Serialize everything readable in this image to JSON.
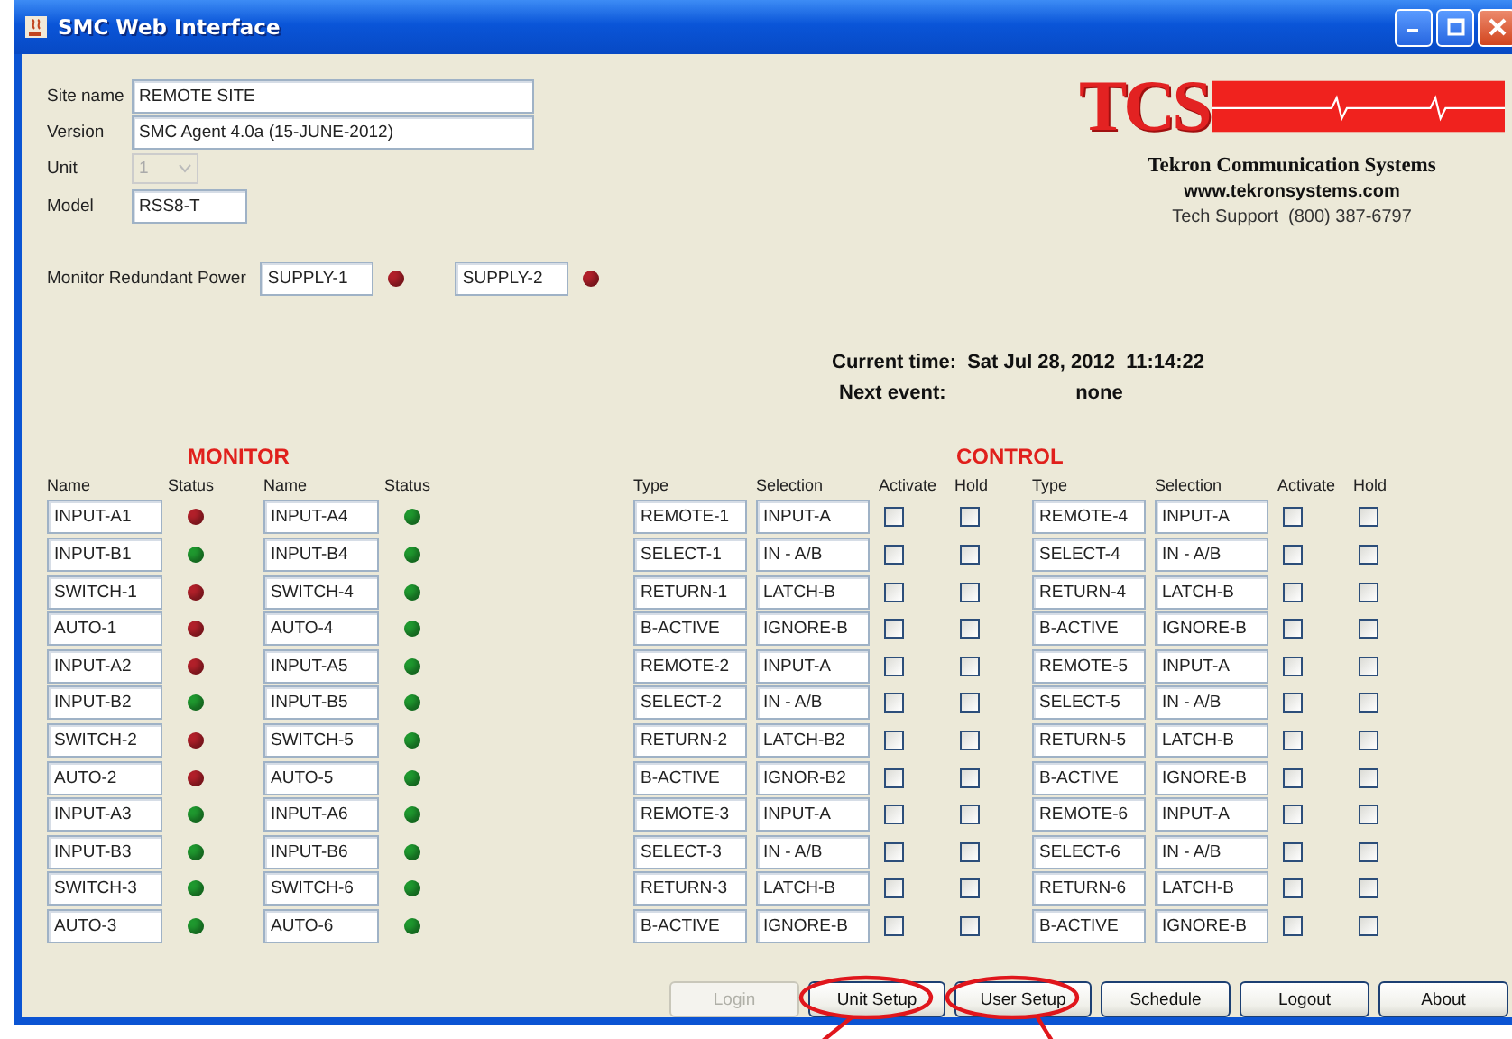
{
  "window": {
    "title": "SMC Web Interface"
  },
  "site_info": {
    "fields": [
      {
        "kind": "text",
        "label": "Site name",
        "value": "REMOTE SITE"
      },
      {
        "kind": "text",
        "label": "Version",
        "value": "SMC Agent 4.0a (15-JUNE-2012)"
      },
      {
        "kind": "combo",
        "label": "Unit",
        "value": "1",
        "disabled": true
      },
      {
        "kind": "text",
        "label": "Model",
        "value": "RSS8-T"
      }
    ]
  },
  "redundant_power": {
    "label": "Monitor Redundant Power",
    "supplies": [
      {
        "name": "SUPPLY-1",
        "color": "#b3202a"
      },
      {
        "name": "SUPPLY-2",
        "color": "#b3202a"
      }
    ]
  },
  "logo": {
    "mark": "TCS",
    "company": "Tekron Communication Systems",
    "website": "www.tekronsystems.com",
    "support": "Tech Support  (800) 387-6797"
  },
  "status": {
    "current_time_label": "Current time:",
    "current_time": "Sat Jul 28, 2012  11:14:22",
    "next_event_label": "Next event:",
    "next_event": "none"
  },
  "monitor": {
    "title": "MONITOR",
    "columns": [
      "Name",
      "Status",
      "Name",
      "Status"
    ],
    "rows": [
      {
        "items": [
          {
            "name": "INPUT-A1",
            "color": "#b3202a"
          },
          {
            "name": "INPUT-A4",
            "color": "#1f9a2f"
          }
        ]
      },
      {
        "items": [
          {
            "name": "INPUT-B1",
            "color": "#1f9a2f"
          },
          {
            "name": "INPUT-B4",
            "color": "#1f9a2f"
          }
        ]
      },
      {
        "items": [
          {
            "name": "SWITCH-1",
            "color": "#b3202a"
          },
          {
            "name": "SWITCH-4",
            "color": "#1f9a2f"
          }
        ]
      },
      {
        "items": [
          {
            "name": "AUTO-1",
            "color": "#b3202a"
          },
          {
            "name": "AUTO-4",
            "color": "#1f9a2f"
          }
        ]
      },
      {
        "items": [
          {
            "name": "INPUT-A2",
            "color": "#b3202a"
          },
          {
            "name": "INPUT-A5",
            "color": "#1f9a2f"
          }
        ]
      },
      {
        "items": [
          {
            "name": "INPUT-B2",
            "color": "#1f9a2f"
          },
          {
            "name": "INPUT-B5",
            "color": "#1f9a2f"
          }
        ]
      },
      {
        "items": [
          {
            "name": "SWITCH-2",
            "color": "#b3202a"
          },
          {
            "name": "SWITCH-5",
            "color": "#1f9a2f"
          }
        ]
      },
      {
        "items": [
          {
            "name": "AUTO-2",
            "color": "#b3202a"
          },
          {
            "name": "AUTO-5",
            "color": "#1f9a2f"
          }
        ]
      },
      {
        "items": [
          {
            "name": "INPUT-A3",
            "color": "#1f9a2f"
          },
          {
            "name": "INPUT-A6",
            "color": "#1f9a2f"
          }
        ]
      },
      {
        "items": [
          {
            "name": "INPUT-B3",
            "color": "#1f9a2f"
          },
          {
            "name": "INPUT-B6",
            "color": "#1f9a2f"
          }
        ]
      },
      {
        "items": [
          {
            "name": "SWITCH-3",
            "color": "#1f9a2f"
          },
          {
            "name": "SWITCH-6",
            "color": "#1f9a2f"
          }
        ]
      },
      {
        "items": [
          {
            "name": "AUTO-3",
            "color": "#1f9a2f"
          },
          {
            "name": "AUTO-6",
            "color": "#1f9a2f"
          }
        ]
      }
    ]
  },
  "control": {
    "title": "CONTROL",
    "columns": [
      "Type",
      "Selection",
      "Activate",
      "Hold",
      "Type",
      "Selection",
      "Activate",
      "Hold"
    ],
    "rows": [
      {
        "items": [
          {
            "type": "REMOTE-1",
            "selection": "INPUT-A",
            "activate": false,
            "hold": false
          },
          {
            "type": "REMOTE-4",
            "selection": "INPUT-A",
            "activate": false,
            "hold": false
          }
        ]
      },
      {
        "items": [
          {
            "type": "SELECT-1",
            "selection": "IN - A/B",
            "activate": false,
            "hold": false
          },
          {
            "type": "SELECT-4",
            "selection": "IN - A/B",
            "activate": false,
            "hold": false
          }
        ]
      },
      {
        "items": [
          {
            "type": "RETURN-1",
            "selection": "LATCH-B",
            "activate": false,
            "hold": false
          },
          {
            "type": "RETURN-4",
            "selection": "LATCH-B",
            "activate": false,
            "hold": false
          }
        ]
      },
      {
        "items": [
          {
            "type": "B-ACTIVE",
            "selection": "IGNORE-B",
            "activate": false,
            "hold": false
          },
          {
            "type": "B-ACTIVE",
            "selection": "IGNORE-B",
            "activate": false,
            "hold": false
          }
        ]
      },
      {
        "items": [
          {
            "type": "REMOTE-2",
            "selection": "INPUT-A",
            "activate": false,
            "hold": false
          },
          {
            "type": "REMOTE-5",
            "selection": "INPUT-A",
            "activate": false,
            "hold": false
          }
        ]
      },
      {
        "items": [
          {
            "type": "SELECT-2",
            "selection": "IN - A/B",
            "activate": false,
            "hold": false
          },
          {
            "type": "SELECT-5",
            "selection": "IN - A/B",
            "activate": false,
            "hold": false
          }
        ]
      },
      {
        "items": [
          {
            "type": "RETURN-2",
            "selection": "LATCH-B2",
            "activate": false,
            "hold": false
          },
          {
            "type": "RETURN-5",
            "selection": "LATCH-B",
            "activate": false,
            "hold": false
          }
        ]
      },
      {
        "items": [
          {
            "type": "B-ACTIVE",
            "selection": "IGNOR-B2",
            "activate": false,
            "hold": false
          },
          {
            "type": "B-ACTIVE",
            "selection": "IGNORE-B",
            "activate": false,
            "hold": false
          }
        ]
      },
      {
        "items": [
          {
            "type": "REMOTE-3",
            "selection": "INPUT-A",
            "activate": false,
            "hold": false
          },
          {
            "type": "REMOTE-6",
            "selection": "INPUT-A",
            "activate": false,
            "hold": false
          }
        ]
      },
      {
        "items": [
          {
            "type": "SELECT-3",
            "selection": "IN - A/B",
            "activate": false,
            "hold": false
          },
          {
            "type": "SELECT-6",
            "selection": "IN - A/B",
            "activate": false,
            "hold": false
          }
        ]
      },
      {
        "items": [
          {
            "type": "RETURN-3",
            "selection": "LATCH-B",
            "activate": false,
            "hold": false
          },
          {
            "type": "RETURN-6",
            "selection": "LATCH-B",
            "activate": false,
            "hold": false
          }
        ]
      },
      {
        "items": [
          {
            "type": "B-ACTIVE",
            "selection": "IGNORE-B",
            "activate": false,
            "hold": false
          },
          {
            "type": "B-ACTIVE",
            "selection": "IGNORE-B",
            "activate": false,
            "hold": false
          }
        ]
      }
    ]
  },
  "buttons": [
    {
      "label": "Login",
      "disabled": true,
      "circled": false
    },
    {
      "label": "Unit Setup",
      "disabled": false,
      "circled": true
    },
    {
      "label": "User Setup",
      "disabled": false,
      "circled": true
    },
    {
      "label": "Schedule",
      "disabled": false,
      "circled": false
    },
    {
      "label": "Logout",
      "disabled": false,
      "circled": false
    },
    {
      "label": "About",
      "disabled": false,
      "circled": false
    }
  ]
}
